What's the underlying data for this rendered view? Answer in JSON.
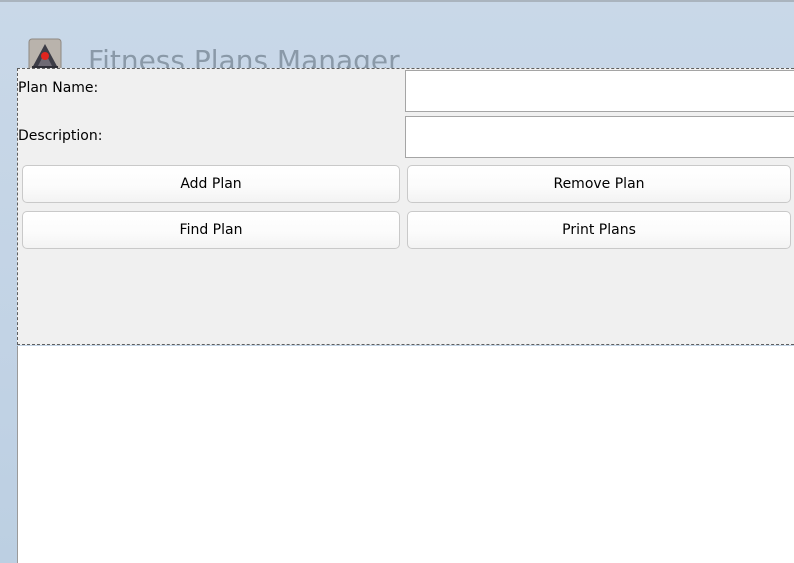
{
  "window": {
    "title": "Fitness Plans Manager"
  },
  "form": {
    "plan_name_label": "Plan Name:",
    "plan_name_value": "",
    "description_label": "Description:",
    "description_value": ""
  },
  "buttons": {
    "add_plan": "Add Plan",
    "remove_plan": "Remove Plan",
    "find_plan": "Find Plan",
    "print_plans": "Print Plans"
  },
  "plans_list": {
    "items": []
  },
  "icons": {
    "app": "java-cup-icon"
  }
}
